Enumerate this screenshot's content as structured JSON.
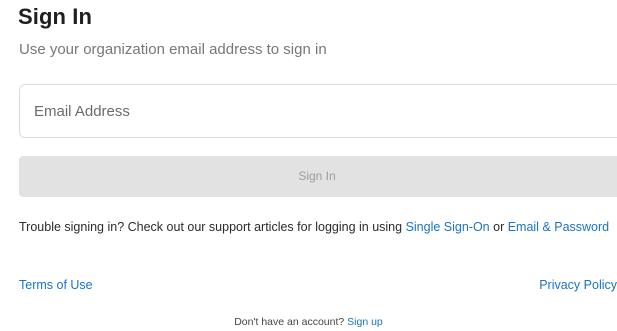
{
  "header": {
    "title": "Sign In",
    "subtitle": "Use your organization email address to sign in"
  },
  "form": {
    "email_placeholder": "Email Address",
    "email_value": "",
    "submit_label": "Sign In"
  },
  "help": {
    "trouble_text": "Trouble signing in? Check out our support articles for logging in using ",
    "sso_link": "Single Sign-On",
    "or_text": " or ",
    "email_password_link": "Email & Password"
  },
  "footer": {
    "terms_link": "Terms of Use",
    "privacy_link": "Privacy Policy",
    "no_account_text": "Don't have an account? ",
    "signup_link": "Sign up"
  },
  "colors": {
    "link": "#1a73c8",
    "button_disabled_bg": "#e2e2e2",
    "button_disabled_text": "#9c9c9c"
  }
}
